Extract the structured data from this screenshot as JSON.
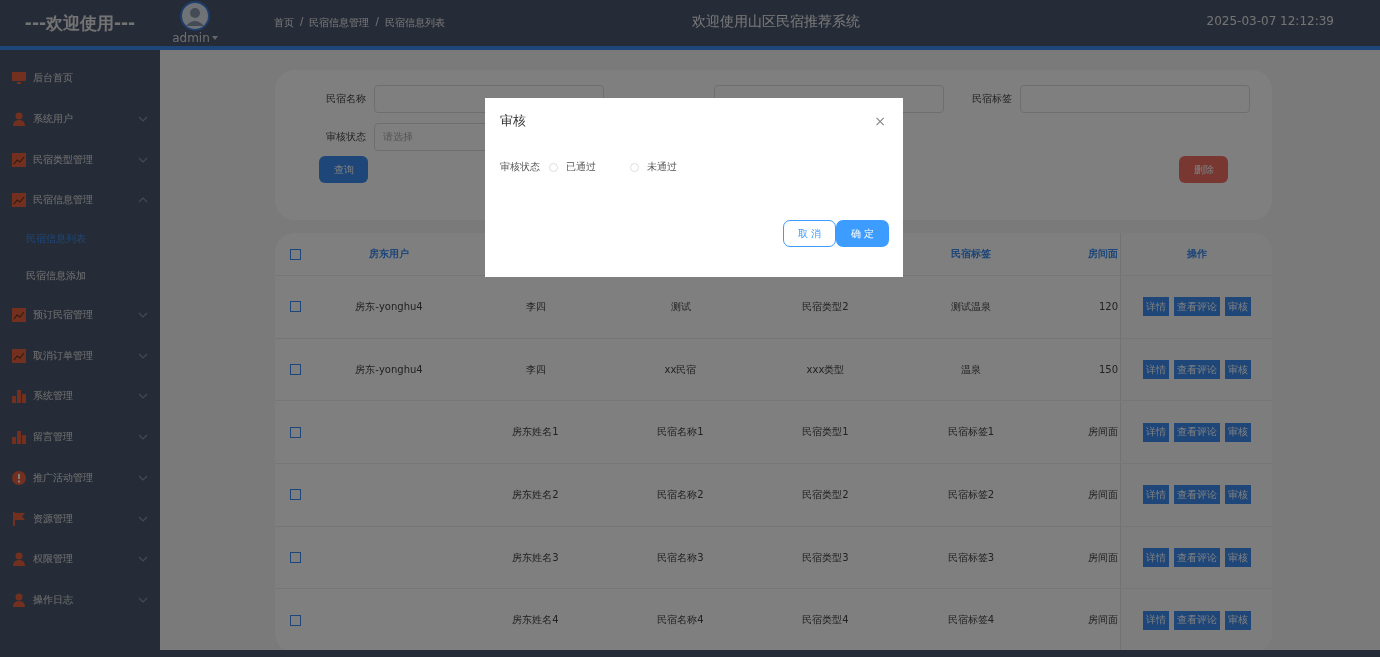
{
  "header": {
    "brand": "---欢迎使用---",
    "user": "admin",
    "breadcrumb": [
      "首页",
      "/",
      "民宿信息管理",
      "/",
      "民宿信息列表"
    ],
    "title": "欢迎使用山区民宿推荐系统",
    "time": "2025-03-07 12:12:39"
  },
  "sidebar": {
    "items": [
      {
        "label": "后台首页",
        "kind": "monitor",
        "expandable": false
      },
      {
        "label": "系统用户",
        "kind": "person",
        "expandable": true,
        "expanded": false
      },
      {
        "label": "民宿类型管理",
        "kind": "chart",
        "expandable": true,
        "expanded": false
      },
      {
        "label": "民宿信息管理",
        "kind": "chart",
        "expandable": true,
        "expanded": true,
        "children": [
          {
            "label": "民宿信息列表",
            "selected": true
          },
          {
            "label": "民宿信息添加",
            "selected": false
          }
        ]
      },
      {
        "label": "预订民宿管理",
        "kind": "chart",
        "expandable": true,
        "expanded": false
      },
      {
        "label": "取消订单管理",
        "kind": "chart",
        "expandable": true,
        "expanded": false
      },
      {
        "label": "系统管理",
        "kind": "bars",
        "expandable": true,
        "expanded": false
      },
      {
        "label": "留言管理",
        "kind": "bars",
        "expandable": true,
        "expanded": false
      },
      {
        "label": "推广活动管理",
        "kind": "info",
        "expandable": true,
        "expanded": false
      },
      {
        "label": "资源管理",
        "kind": "flag",
        "expandable": true,
        "expanded": false
      },
      {
        "label": "权限管理",
        "kind": "person",
        "expandable": true,
        "expanded": false
      },
      {
        "label": "操作日志",
        "kind": "person",
        "expandable": true,
        "expanded": false
      }
    ]
  },
  "filters": {
    "fields": [
      {
        "label": "民宿名称",
        "kind": "text"
      },
      {
        "kind": "select"
      },
      {
        "label": "民宿标签",
        "kind": "text"
      },
      {
        "label": "审核状态",
        "kind": "select",
        "placeholder": "请选择"
      }
    ],
    "search_button": "查询",
    "delete_button": "删除"
  },
  "table": {
    "all_checked": false,
    "columns": [
      {
        "label": "房东用户"
      },
      {},
      {},
      {},
      {
        "label": "民宿标签"
      },
      {
        "label": "房间面"
      },
      {
        "label": "操作"
      }
    ],
    "rows": [
      {
        "checked": false,
        "cells": [
          "房东-yonghu4",
          "李四",
          "测试",
          "民宿类型2",
          "测试温泉",
          "120"
        ],
        "actions": [
          "详情",
          "查看评论",
          "审核"
        ]
      },
      {
        "checked": false,
        "cells": [
          "房东-yonghu4",
          "李四",
          "xx民宿",
          "xxx类型",
          "温泉",
          "150"
        ],
        "actions": [
          "详情",
          "查看评论",
          "审核"
        ]
      },
      {
        "checked": false,
        "cells": [
          "",
          "房东姓名1",
          "民宿名称1",
          "民宿类型1",
          "民宿标签1",
          "房间面"
        ],
        "actions": [
          "详情",
          "查看评论",
          "审核"
        ]
      },
      {
        "checked": false,
        "cells": [
          "",
          "房东姓名2",
          "民宿名称2",
          "民宿类型2",
          "民宿标签2",
          "房间面"
        ],
        "actions": [
          "详情",
          "查看评论",
          "审核"
        ]
      },
      {
        "checked": false,
        "cells": [
          "",
          "房东姓名3",
          "民宿名称3",
          "民宿类型3",
          "民宿标签3",
          "房间面"
        ],
        "actions": [
          "详情",
          "查看评论",
          "审核"
        ]
      },
      {
        "checked": false,
        "cells": [
          "",
          "房东姓名4",
          "民宿名称4",
          "民宿类型4",
          "民宿标签4",
          "房间面"
        ],
        "actions": [
          "详情",
          "查看评论",
          "审核"
        ]
      }
    ]
  },
  "dialog": {
    "title": "审核",
    "close": "×",
    "field_label": "审核状态",
    "options": [
      {
        "label": "已通过",
        "selected": false
      },
      {
        "label": "未通过",
        "selected": false
      }
    ],
    "cancel": "取 消",
    "confirm": "确 定"
  }
}
